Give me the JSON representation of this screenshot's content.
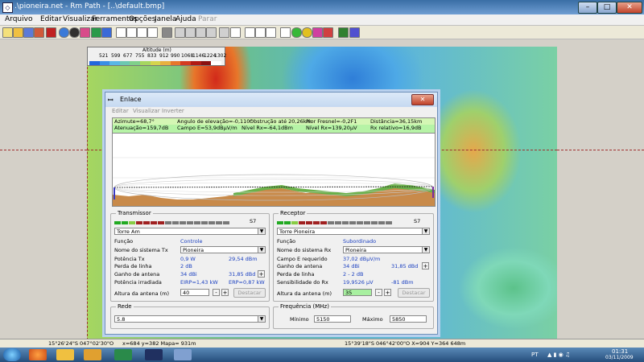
{
  "window": {
    "title": ".\\pioneira.net - Rm Path - [..\\default.bmp]",
    "minimize": "–",
    "maximize": "□",
    "close": "✕"
  },
  "menu": {
    "items": [
      "Arquivo",
      "Editar",
      "Visualizar",
      "Ferramentas",
      "Opções",
      "Janela",
      "Ajuda",
      "Parar"
    ]
  },
  "legend": {
    "title": "Altitude (m)",
    "ticks": [
      "521",
      "599",
      "677",
      "755",
      "833",
      "912",
      "990",
      "1068",
      "1146",
      "1224",
      "1302"
    ],
    "colors": [
      "#2266dd",
      "#3a8ee6",
      "#59b6e6",
      "#6cc8b0",
      "#7fd08a",
      "#a6d660",
      "#d6d44c",
      "#e8b040",
      "#e8762a",
      "#d43a20",
      "#b01a14",
      "#8a1010",
      "#ffffff"
    ]
  },
  "dialog": {
    "title": "Enlace",
    "menu": [
      "Editar",
      "Visualizar",
      "Inverter"
    ],
    "info": {
      "azimute": "Azimute=68,7°",
      "angulo": "Angulo de elevação=-0,110°",
      "obstrucao": "Obstrução até 20,26km",
      "pior_fresnel": "Pior Fresnel=-0,2F1",
      "distancia": "Distância=36,15km",
      "atenuacao": "Atenuação=159,7dB",
      "campo": "Campo E=53,9dBµV/m",
      "nivel_rx": "Nível Rx=-64,1dBm",
      "nivel_rx_uv": "Nível Rx=139,20µV",
      "rx_relativo": "Rx relativo=16,9dB"
    },
    "transmissor": {
      "label": "Transmissor",
      "signal": "S7",
      "selected": "Torre Am",
      "funcao_label": "Função",
      "funcao": "Controle",
      "nome_label": "Nome do sistema Tx",
      "nome": "Pioneira",
      "potencia_label": "Potência Tx",
      "potencia_w": "0,9 W",
      "potencia_dbm": "29,54 dBm",
      "perda_label": "Perda de linha",
      "perda": "2 dB",
      "ganho_label": "Ganho de antena",
      "ganho_dbi": "34 dBi",
      "ganho_dbd": "31,85 dBd",
      "plus": "+",
      "irradiada_label": "Potência irradiada",
      "eirp": "EIRP=1,43 kW",
      "erp": "ERP=0,87 kW",
      "altura_label": "Altura da antena (m)",
      "altura": "40",
      "minus": "-",
      "btn": "Destacar"
    },
    "receptor": {
      "label": "Receptor",
      "signal": "S7",
      "selected": "Torre Pioneira",
      "funcao_label": "Função",
      "funcao": "Subordinado",
      "nome_label": "Nome do sistema Rx",
      "nome": "Pioneira",
      "campo_label": "Campo E requerido",
      "campo": "37,02 dBµV/m",
      "ganho_label": "Ganho de antena",
      "ganho_dbi": "34 dBi",
      "ganho_dbd": "31,85 dBd",
      "plus": "+",
      "perda_label": "Perda de linha",
      "perda": "2 - 2 dB",
      "sens_label": "Sensibilidade do Rx",
      "sens_uv": "19,9526 µV",
      "sens_dbm": "-81 dBm",
      "altura_label": "Altura da antena (m)",
      "altura": "35",
      "minus": "-",
      "btn": "Destacar"
    },
    "rede": {
      "label": "Rede",
      "selected": "5.8"
    },
    "frequencia": {
      "label": "Frequência (MHz)",
      "min_label": "Mínimo",
      "min": "5150",
      "max_label": "Máximo",
      "max": "5850"
    }
  },
  "statusbar": {
    "coord_left": "15°26'24\"S 047°02'30\"O",
    "xy": "x=684 y=382 Mapa= 931m",
    "coord_right": "15°39'18\"S 046°42'00\"O X=904 Y=364 648m"
  },
  "taskbar": {
    "lang": "PT",
    "time": "01:31",
    "date": "03/11/2009"
  }
}
